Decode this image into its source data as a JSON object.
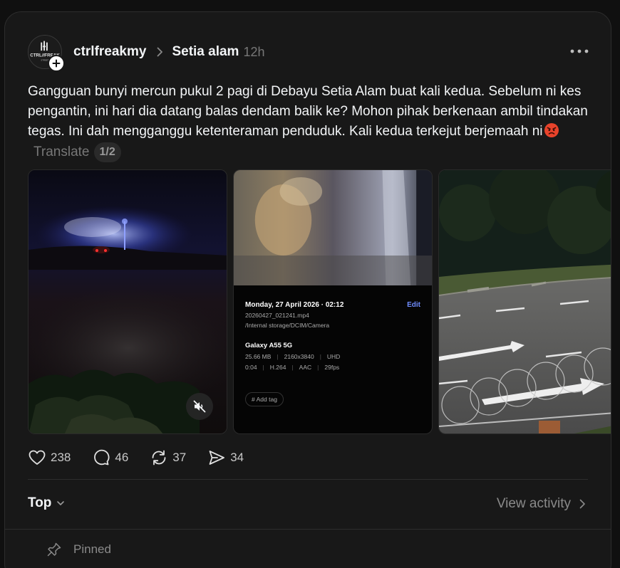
{
  "post": {
    "author": "ctrlfreakmy",
    "community": "Setia alam",
    "time": "12h",
    "text": "Gangguan bunyi mercun pukul 2 pagi di Debayu Setia Alam buat kali kedua. Sebelum ni kes pengantin, ini hari dia datang balas dendam balik ke? Mohon pihak berkenaan ambil tindakan tegas. Ini dah mengganggu ketenteraman penduduk. Kali kedua terkejut berjemaah ni",
    "emoji": "angry-face-emoji",
    "translate_label": "Translate",
    "page_indicator": "1/2",
    "avatar_text": "CTRL//FREAK"
  },
  "media": {
    "screenshot": {
      "date": "Monday, 27 April 2026 · 02:12",
      "edit_label": "Edit",
      "filename": "20260427_021241.mp4",
      "path": "/Internal storage/DCIM/Camera",
      "device": "Galaxy A55 5G",
      "size": "25.66 MB",
      "resolution": "2160x3840",
      "quality": "UHD",
      "duration": "0:04",
      "codec": "H.264",
      "audio": "AAC",
      "fps": "29fps",
      "tag_label": "# Add tag"
    }
  },
  "actions": {
    "likes": "238",
    "comments": "46",
    "reposts": "37",
    "shares": "34"
  },
  "footer": {
    "sort_label": "Top",
    "view_activity_label": "View activity",
    "pinned_label": "Pinned"
  },
  "icons": [
    "plus-icon",
    "chevron-right-icon",
    "more-icon",
    "mute-icon",
    "heart-icon",
    "comment-icon",
    "repost-icon",
    "share-icon",
    "chevron-down-icon",
    "pin-icon"
  ],
  "colors": {
    "background": "#101010",
    "card": "#181818",
    "text": "#f3f5f7",
    "muted": "#777777",
    "edit_blue": "#6f8cff"
  }
}
